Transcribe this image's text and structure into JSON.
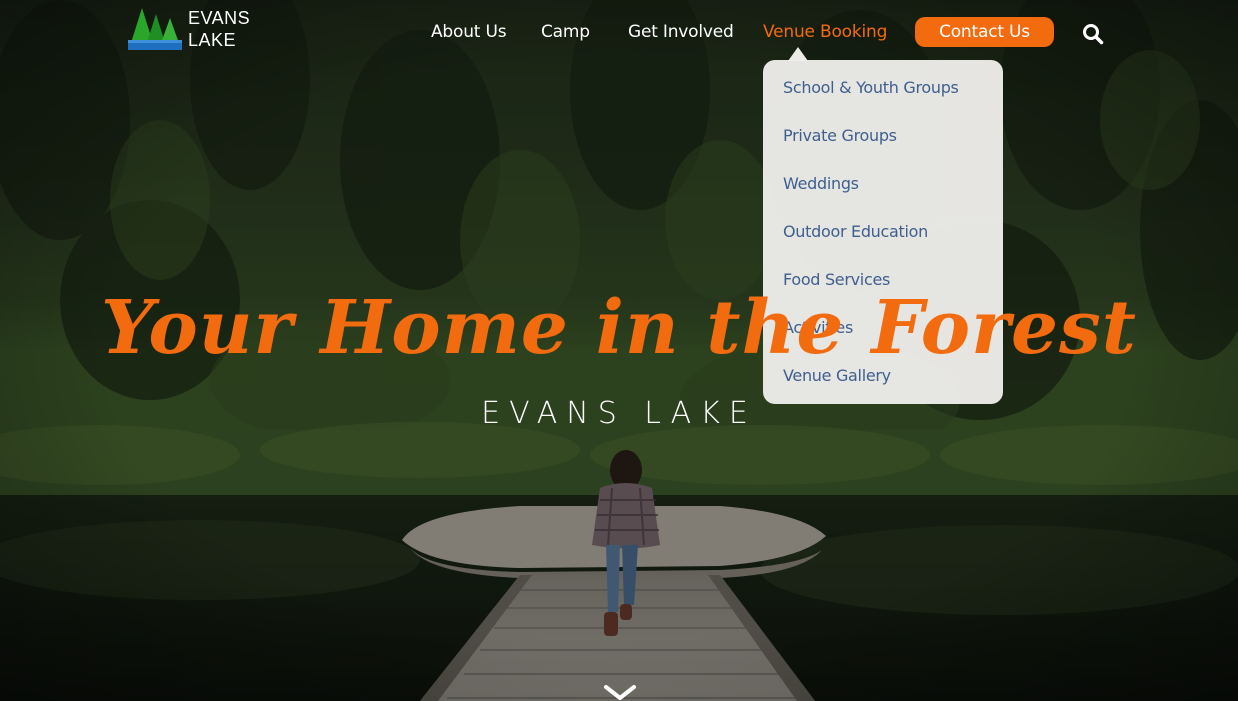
{
  "logo": {
    "line1": "EVANS",
    "line2": "LAKE",
    "icon": "pine-trees-logo-icon"
  },
  "nav": {
    "about": "About Us",
    "camp": "Camp",
    "get_involved": "Get Involved",
    "venue_booking": "Venue Booking",
    "contact": "Contact Us",
    "search_icon": "search-icon"
  },
  "dropdown": {
    "items": [
      "School & Youth Groups",
      "Private Groups",
      "Weddings",
      "Outdoor Education",
      "Food Services",
      "Activities",
      "Venue Gallery"
    ]
  },
  "hero": {
    "headline": "Your Home in the Forest",
    "subheading": "EVANS LAKE",
    "scroll_icon": "chevron-down-icon"
  },
  "colors": {
    "accent": "#f26b0f",
    "dropdown_bg": "#eeedea",
    "dropdown_text": "#3f5f8f",
    "nav_text": "#ffffff"
  }
}
